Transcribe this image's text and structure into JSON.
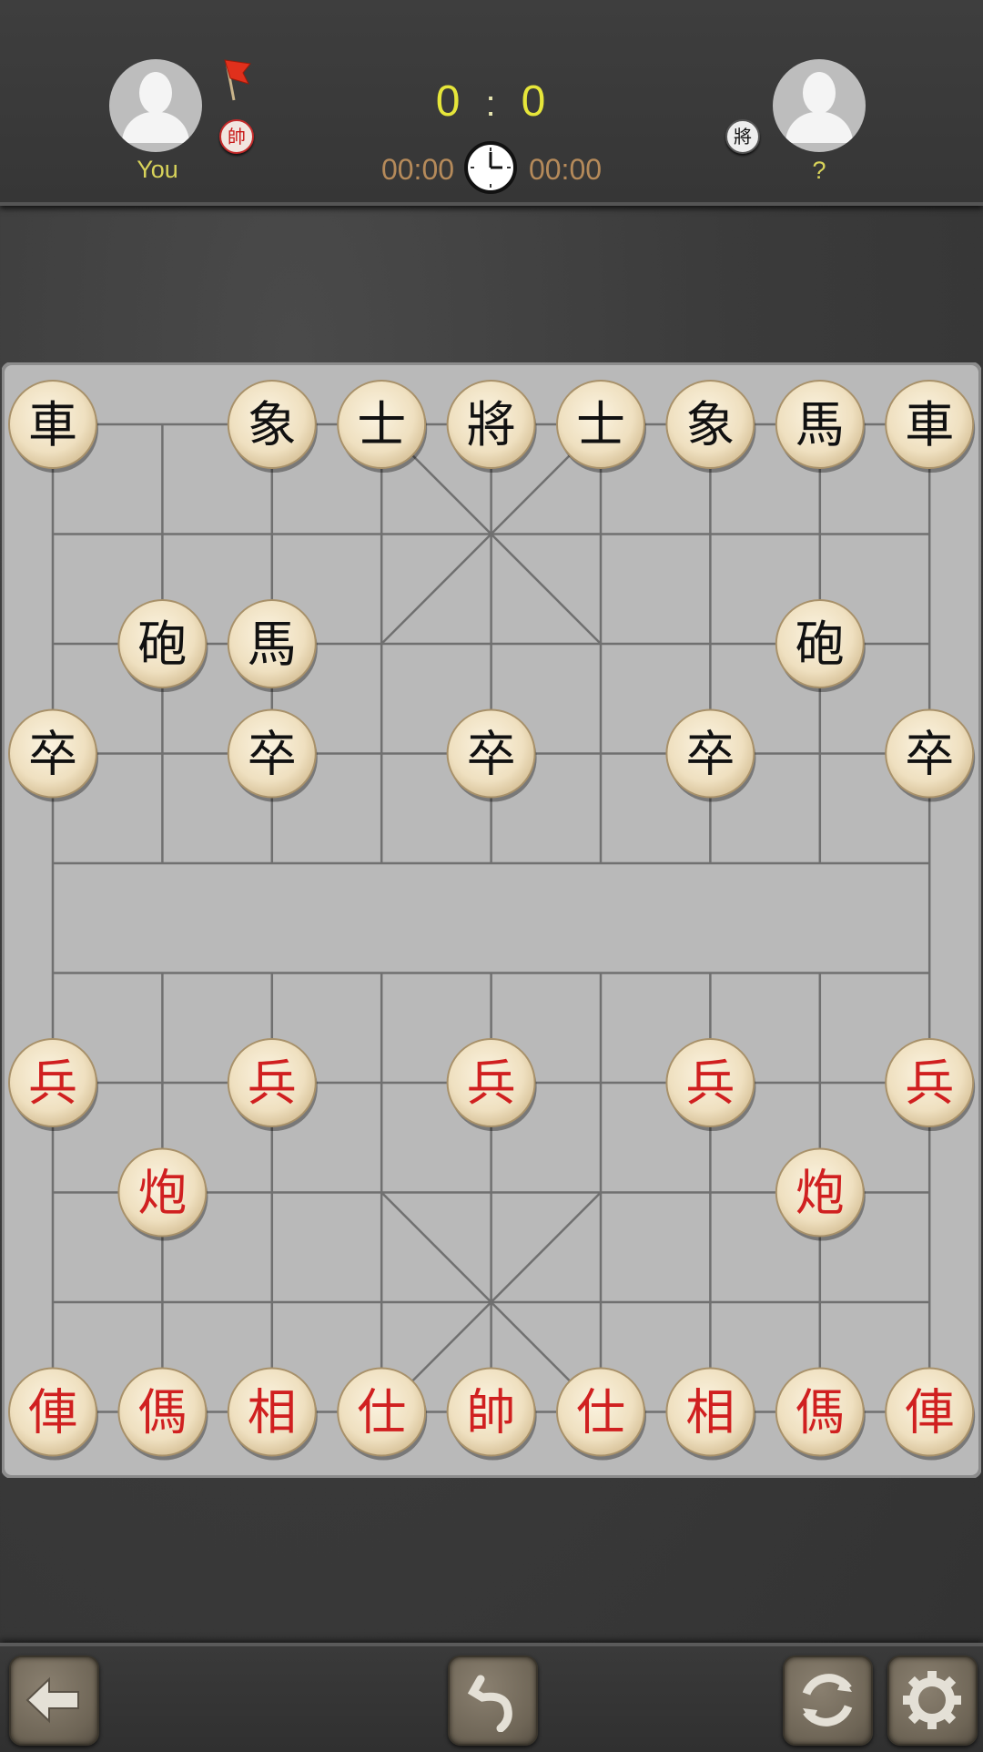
{
  "players": {
    "you": {
      "name": "You",
      "side_badge": "帥",
      "turn_flag": "red-flag-icon"
    },
    "opponent": {
      "name": "?",
      "side_badge": "將"
    }
  },
  "score": {
    "you": "0",
    "separator": ":",
    "opponent": "0"
  },
  "timers": {
    "you": "00:00",
    "opponent": "00:00",
    "icon": "clock-icon"
  },
  "colors": {
    "red_piece_text": "#d02020",
    "black_piece_text": "#111111",
    "board": "#b9b9b9",
    "score": "#e6e63a",
    "timer": "#b58a5a",
    "name": "#d8d35a"
  },
  "pieces": [
    {
      "char": "車",
      "side": "black",
      "file": 0,
      "rank": 0
    },
    {
      "char": "象",
      "side": "black",
      "file": 2,
      "rank": 0
    },
    {
      "char": "士",
      "side": "black",
      "file": 3,
      "rank": 0
    },
    {
      "char": "將",
      "side": "black",
      "file": 4,
      "rank": 0
    },
    {
      "char": "士",
      "side": "black",
      "file": 5,
      "rank": 0
    },
    {
      "char": "象",
      "side": "black",
      "file": 6,
      "rank": 0
    },
    {
      "char": "馬",
      "side": "black",
      "file": 7,
      "rank": 0
    },
    {
      "char": "車",
      "side": "black",
      "file": 8,
      "rank": 0
    },
    {
      "char": "砲",
      "side": "black",
      "file": 1,
      "rank": 2
    },
    {
      "char": "馬",
      "side": "black",
      "file": 2,
      "rank": 2
    },
    {
      "char": "砲",
      "side": "black",
      "file": 7,
      "rank": 2
    },
    {
      "char": "卒",
      "side": "black",
      "file": 0,
      "rank": 3
    },
    {
      "char": "卒",
      "side": "black",
      "file": 2,
      "rank": 3
    },
    {
      "char": "卒",
      "side": "black",
      "file": 4,
      "rank": 3
    },
    {
      "char": "卒",
      "side": "black",
      "file": 6,
      "rank": 3
    },
    {
      "char": "卒",
      "side": "black",
      "file": 8,
      "rank": 3
    },
    {
      "char": "兵",
      "side": "red",
      "file": 0,
      "rank": 6
    },
    {
      "char": "兵",
      "side": "red",
      "file": 2,
      "rank": 6
    },
    {
      "char": "兵",
      "side": "red",
      "file": 4,
      "rank": 6
    },
    {
      "char": "兵",
      "side": "red",
      "file": 6,
      "rank": 6
    },
    {
      "char": "兵",
      "side": "red",
      "file": 8,
      "rank": 6
    },
    {
      "char": "炮",
      "side": "red",
      "file": 1,
      "rank": 7
    },
    {
      "char": "炮",
      "side": "red",
      "file": 7,
      "rank": 7
    },
    {
      "char": "俥",
      "side": "red",
      "file": 0,
      "rank": 9
    },
    {
      "char": "傌",
      "side": "red",
      "file": 1,
      "rank": 9
    },
    {
      "char": "相",
      "side": "red",
      "file": 2,
      "rank": 9
    },
    {
      "char": "仕",
      "side": "red",
      "file": 3,
      "rank": 9
    },
    {
      "char": "帥",
      "side": "red",
      "file": 4,
      "rank": 9
    },
    {
      "char": "仕",
      "side": "red",
      "file": 5,
      "rank": 9
    },
    {
      "char": "相",
      "side": "red",
      "file": 6,
      "rank": 9
    },
    {
      "char": "傌",
      "side": "red",
      "file": 7,
      "rank": 9
    },
    {
      "char": "俥",
      "side": "red",
      "file": 8,
      "rank": 9
    }
  ],
  "toolbar": {
    "back": "back-arrow-icon",
    "undo": "undo-icon",
    "restart": "restart-icon",
    "settings": "gear-icon"
  }
}
